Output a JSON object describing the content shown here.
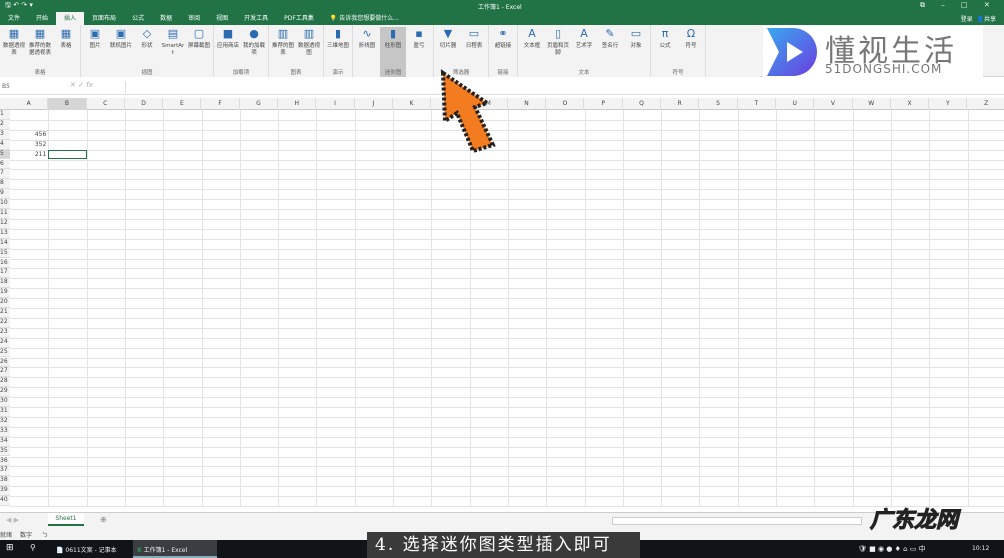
{
  "window": {
    "title": "工作簿1 - Excel",
    "controls": [
      "⧉",
      "–",
      "□",
      "✕"
    ],
    "user": "登录",
    "share": "共享"
  },
  "tabs": [
    "文件",
    "开始",
    "插入",
    "页面布局",
    "公式",
    "数据",
    "审阅",
    "视图",
    "开发工具",
    "PDF工具集"
  ],
  "active_tab": "插入",
  "tell_me": "告诉我您想要做什么...",
  "ribbon": [
    {
      "label": "表格",
      "buttons": [
        {
          "label": "数据透视表",
          "icon": "pivot-table-icon"
        },
        {
          "label": "推荐的数据透视表",
          "icon": "recommended-pivot-icon"
        },
        {
          "label": "表格",
          "icon": "table-icon"
        }
      ]
    },
    {
      "label": "插图",
      "buttons": [
        {
          "label": "图片",
          "icon": "picture-icon"
        },
        {
          "label": "联机图片",
          "icon": "online-picture-icon"
        },
        {
          "label": "形状",
          "icon": "shapes-icon"
        },
        {
          "label": "SmartArt",
          "icon": "smartart-icon"
        },
        {
          "label": "屏幕截图",
          "icon": "screenshot-icon"
        }
      ]
    },
    {
      "label": "加载项",
      "buttons": [
        {
          "label": "应用商店",
          "icon": "store-icon"
        },
        {
          "label": "我的加载项",
          "icon": "addins-icon"
        }
      ]
    },
    {
      "label": "图表",
      "buttons": [
        {
          "label": "推荐的图表",
          "icon": "recommended-chart-icon"
        },
        {
          "label": "数据透视图",
          "icon": "pivot-chart-icon"
        }
      ]
    },
    {
      "label": "演示",
      "buttons": [
        {
          "label": "三维地图",
          "icon": "3d-map-icon"
        }
      ]
    },
    {
      "label": "迷你图",
      "buttons": [
        {
          "label": "折线图",
          "icon": "sparkline-line-icon"
        },
        {
          "label": "柱形图",
          "icon": "sparkline-column-icon",
          "selected": true
        },
        {
          "label": "盈亏",
          "icon": "sparkline-winloss-icon"
        }
      ]
    },
    {
      "label": "筛选器",
      "buttons": [
        {
          "label": "切片器",
          "icon": "slicer-icon"
        },
        {
          "label": "日程表",
          "icon": "timeline-icon"
        }
      ]
    },
    {
      "label": "链接",
      "buttons": [
        {
          "label": "超链接",
          "icon": "hyperlink-icon"
        }
      ]
    },
    {
      "label": "文本",
      "buttons": [
        {
          "label": "文本框",
          "icon": "textbox-icon"
        },
        {
          "label": "页眉和页脚",
          "icon": "header-footer-icon"
        },
        {
          "label": "艺术字",
          "icon": "wordart-icon"
        },
        {
          "label": "签名行",
          "icon": "signature-icon"
        },
        {
          "label": "对象",
          "icon": "object-icon"
        }
      ]
    },
    {
      "label": "符号",
      "buttons": [
        {
          "label": "公式",
          "icon": "equation-icon"
        },
        {
          "label": "符号",
          "icon": "symbol-icon"
        }
      ]
    }
  ],
  "name_box": "B5",
  "fx": "fx",
  "columns": [
    "A",
    "B",
    "C",
    "D",
    "E",
    "F",
    "G",
    "H",
    "I",
    "J",
    "K",
    "L",
    "M",
    "N",
    "O",
    "P",
    "Q",
    "R",
    "S",
    "T",
    "U",
    "V",
    "W",
    "X",
    "Y",
    "Z"
  ],
  "row_count": 40,
  "cells": {
    "A3": "456",
    "A4": "352",
    "A5": "211"
  },
  "sheet_tab": "Sheet1",
  "status": [
    "就绪",
    "数字",
    "ㄅ"
  ],
  "taskbar": {
    "apps": [
      "0611文案 - 记事本",
      "工作簿1 - Excel"
    ],
    "ime": "中",
    "time": "10:12"
  },
  "caption": "4. 选择迷你图类型插入即可",
  "watermarks": {
    "logo_cn": "懂视生活",
    "logo_en": "51DONGSHI.COM",
    "site": "广东龙网"
  },
  "colors": {
    "excel_green": "#217346",
    "arrow": "#f47c20"
  }
}
